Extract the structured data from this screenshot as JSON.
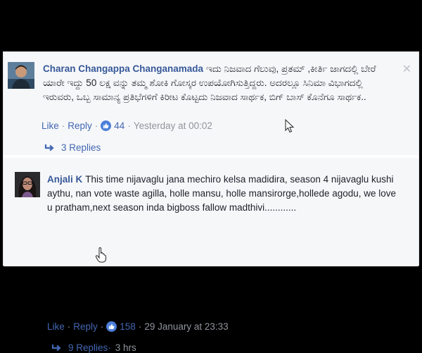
{
  "comments": [
    {
      "author": "Charan Changappa Changanamada",
      "text": "ಇದು ನಿಜವಾದ ಗೆಲುವು, ಪ್ರತಮ್ ,ಕೀರ್ತಿ ಜಾಗದಲ್ಲಿ ಬೇರೆ ಯಾರೇ ಇದ್ದು 50 ಲಕ್ಷ ವನ್ನು ತಮ್ಮ ಶೋಕಿ ಗೋಸ್ಕರ ಉಪಯೋಗಿಸುತ್ತಿದ್ದರು. ಅದರಲ್ಲೂ ಸಿನಿಮಾ ವಿಭಾಗದಲ್ಲಿ ಇರುವರು, ಒಬ್ಬ ಸಾಮಾನ್ಯ ಪ್ರತಿಭೆಗಳಿಗೆ ಕಿರೀಟ ಕೊಟ್ಟದು ನಿಜವಾದ ಸಾರ್ಥಕ, ಬಿಗ್ ಬಾಸ್ ಕೊನೆಗೂ ಸಾರ್ಥಕ..",
      "like_label": "Like",
      "reply_label": "Reply",
      "reactions": "44",
      "timestamp": "Yesterday at 00:02",
      "replies_label": "3 Replies",
      "close_glyph": "✕"
    },
    {
      "author": "Anjali K",
      "text": "This time nijavaglu jana mechiro kelsa madidira, season 4 nijavaglu kushi aythu, nan vote waste agilla, holle mansu, holle mansirorge,hollede agodu, we love u pratham,next season inda bigboss fallow madthivi............",
      "like_label": "Like",
      "reply_label": "Reply",
      "reactions": "158",
      "timestamp": "29 January at 23:33",
      "replies_label": "9 Replies",
      "replies_time": "3 hrs"
    }
  ],
  "colors": {
    "link": "#4267b2",
    "author": "#365899",
    "meta": "#90949c",
    "like_badge": "#4b7ed8",
    "comment_bg": "#f6f7f9"
  }
}
